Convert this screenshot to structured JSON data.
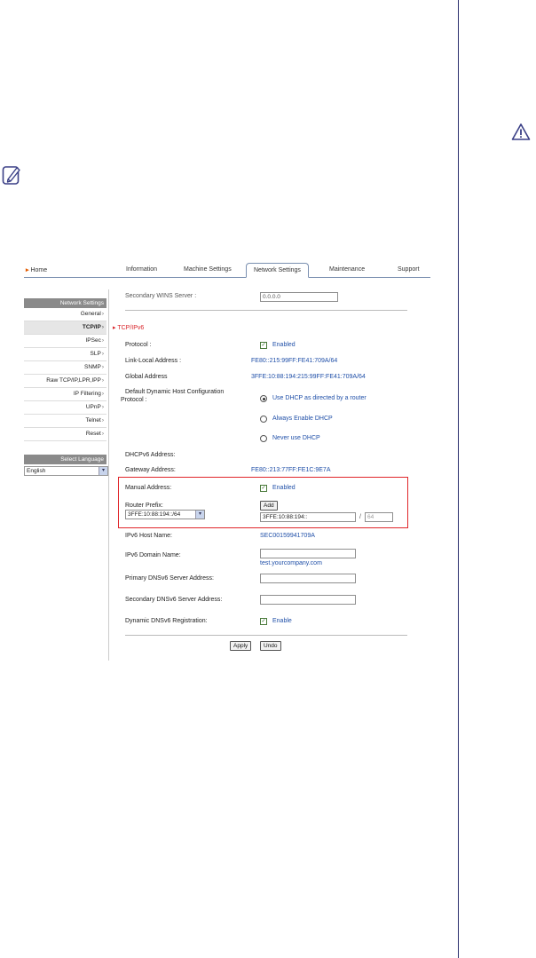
{
  "tabs": {
    "home": "Home",
    "information": "Information",
    "machine_settings": "Machine Settings",
    "network_settings": "Network Settings",
    "maintenance": "Maintenance",
    "support": "Support"
  },
  "sidebar": {
    "header": "Network Settings",
    "items": [
      "General",
      "TCP/IP",
      "IPSec",
      "SLP",
      "SNMP",
      "Raw TCP/IP,LPR,IPP",
      "IP Filtering",
      "UPnP",
      "Telnet",
      "Reset"
    ],
    "language_header": "Select Language",
    "language_value": "English"
  },
  "form": {
    "secondary_wins_label": "Secondary WINS Server :",
    "secondary_wins_value": "0.0.0.0",
    "section_title": "TCP/IPv6",
    "protocol_label": "Protocol :",
    "protocol_value": "Enabled",
    "link_local_label": "Link-Local Address :",
    "link_local_value": "FE80::215:99FF:FE41:709A/64",
    "global_label": "Global Address",
    "global_value": "3FFE:10:88:194:215:99FF:FE41:709A/64",
    "dhcp_label_1": "Default Dynamic Host Configuration",
    "dhcp_label_2": "Protocol :",
    "dhcp_opt1": "Use DHCP as directed by a router",
    "dhcp_opt2": "Always Enable DHCP",
    "dhcp_opt3": "Never use DHCP",
    "dhcpv6_label": "DHCPv6 Address:",
    "gateway_label": "Gateway Address:",
    "gateway_value": "FE80::213:77FF:FE1C:9E7A",
    "manual_label": "Manual Address:",
    "manual_value": "Enabled",
    "router_prefix_label": "Router Prefix:",
    "router_prefix_select": "3FFE:10:88:194::/64",
    "add_button": "Add",
    "prefix_input": "3FFE:10:88:194::",
    "prefix_sep": "/",
    "prefix_len": "64",
    "hostname_label": "IPv6 Host Name:",
    "hostname_value": "SEC00159941709A",
    "domain_label": "IPv6 Domain Name:",
    "domain_hint": "test.yourcompany.com",
    "primary_dns_label": "Primary DNSv6 Server Address:",
    "secondary_dns_label": "Secondary DNSv6 Server Address:",
    "dyn_dns_label": "Dynamic DNSv6 Registration:",
    "dyn_dns_value": "Enable",
    "apply": "Apply",
    "undo": "Undo"
  },
  "colors": {
    "warning": "#3a3f86",
    "accent_red": "#e0262a",
    "link_blue": "#1f4fa8"
  },
  "icons": {
    "warning": "warning-triangle-icon",
    "note": "note-pencil-icon"
  }
}
